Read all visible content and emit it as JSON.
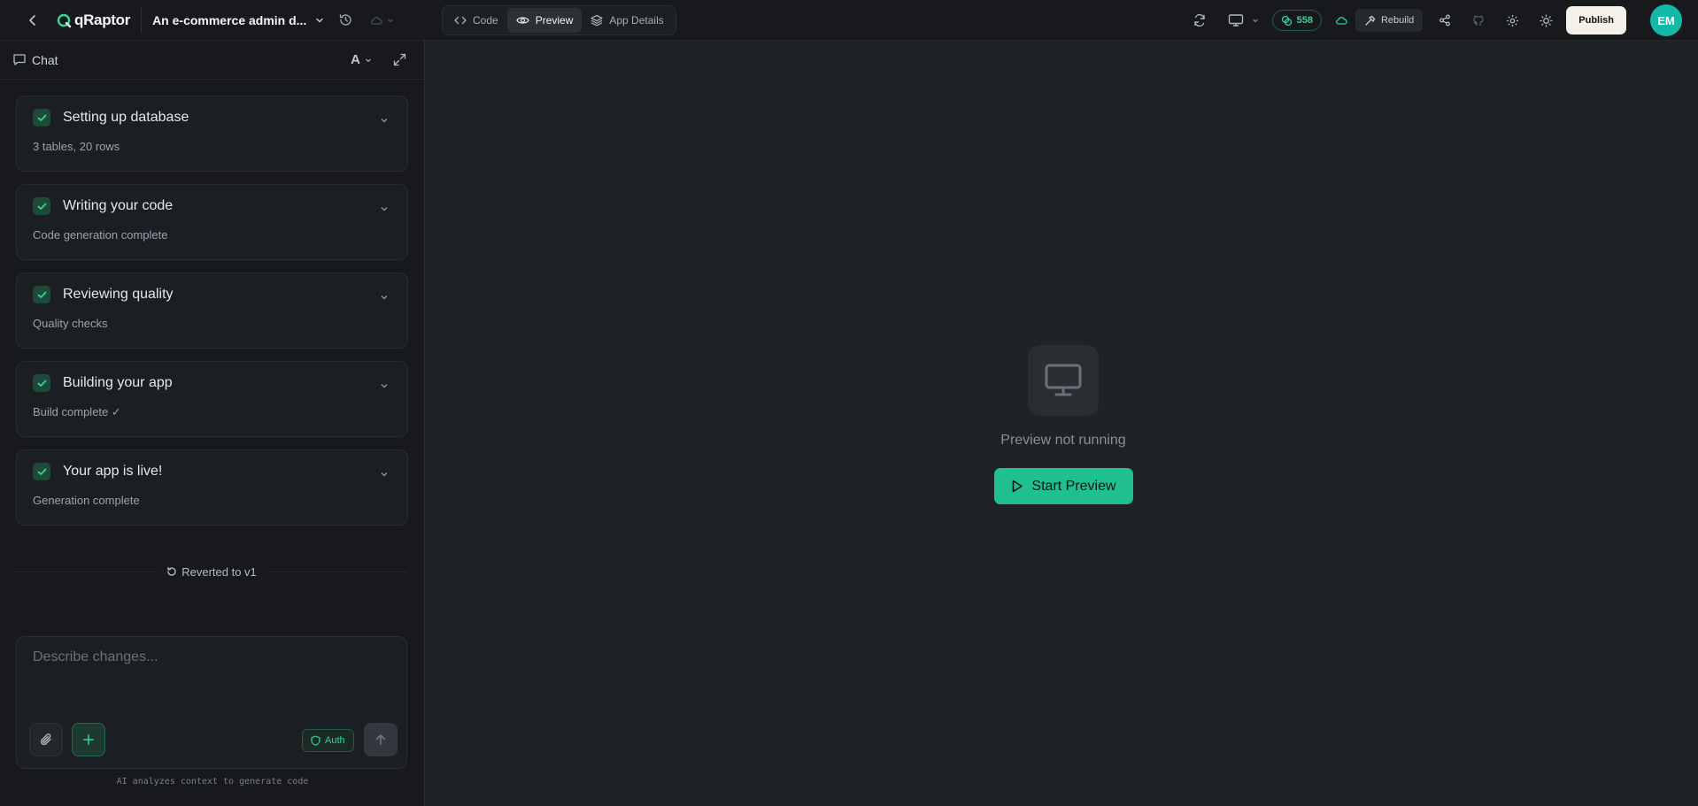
{
  "header": {
    "brand": "qRaptor",
    "app_title": "An e-commerce admin d...",
    "tabs": [
      {
        "label": "Code",
        "icon": "code-icon"
      },
      {
        "label": "Preview",
        "icon": "eye-icon",
        "active": true
      },
      {
        "label": "App Details",
        "icon": "layers-icon"
      }
    ],
    "credits": "558",
    "rebuild_label": "Rebuild",
    "publish_label": "Publish",
    "avatar_initials": "EM"
  },
  "chat": {
    "title": "Chat",
    "font_button": "A",
    "steps": [
      {
        "title": "Setting up database",
        "subtitle": "3 tables, 20 rows"
      },
      {
        "title": "Writing your code",
        "subtitle": "Code generation complete"
      },
      {
        "title": "Reviewing quality",
        "subtitle": "Quality checks"
      },
      {
        "title": "Building your app",
        "subtitle": "Build complete ✓"
      },
      {
        "title": "Your app is live!",
        "subtitle": "Generation complete"
      }
    ],
    "revert_label": "Reverted to v1",
    "composer_placeholder": "Describe changes...",
    "auth_label": "Auth",
    "hint": "AI analyzes context to generate code"
  },
  "preview": {
    "status": "Preview not running",
    "start_label": "Start Preview"
  },
  "colors": {
    "accent": "#1fbf8f",
    "background": "#1f2226",
    "panel": "#17191c"
  }
}
